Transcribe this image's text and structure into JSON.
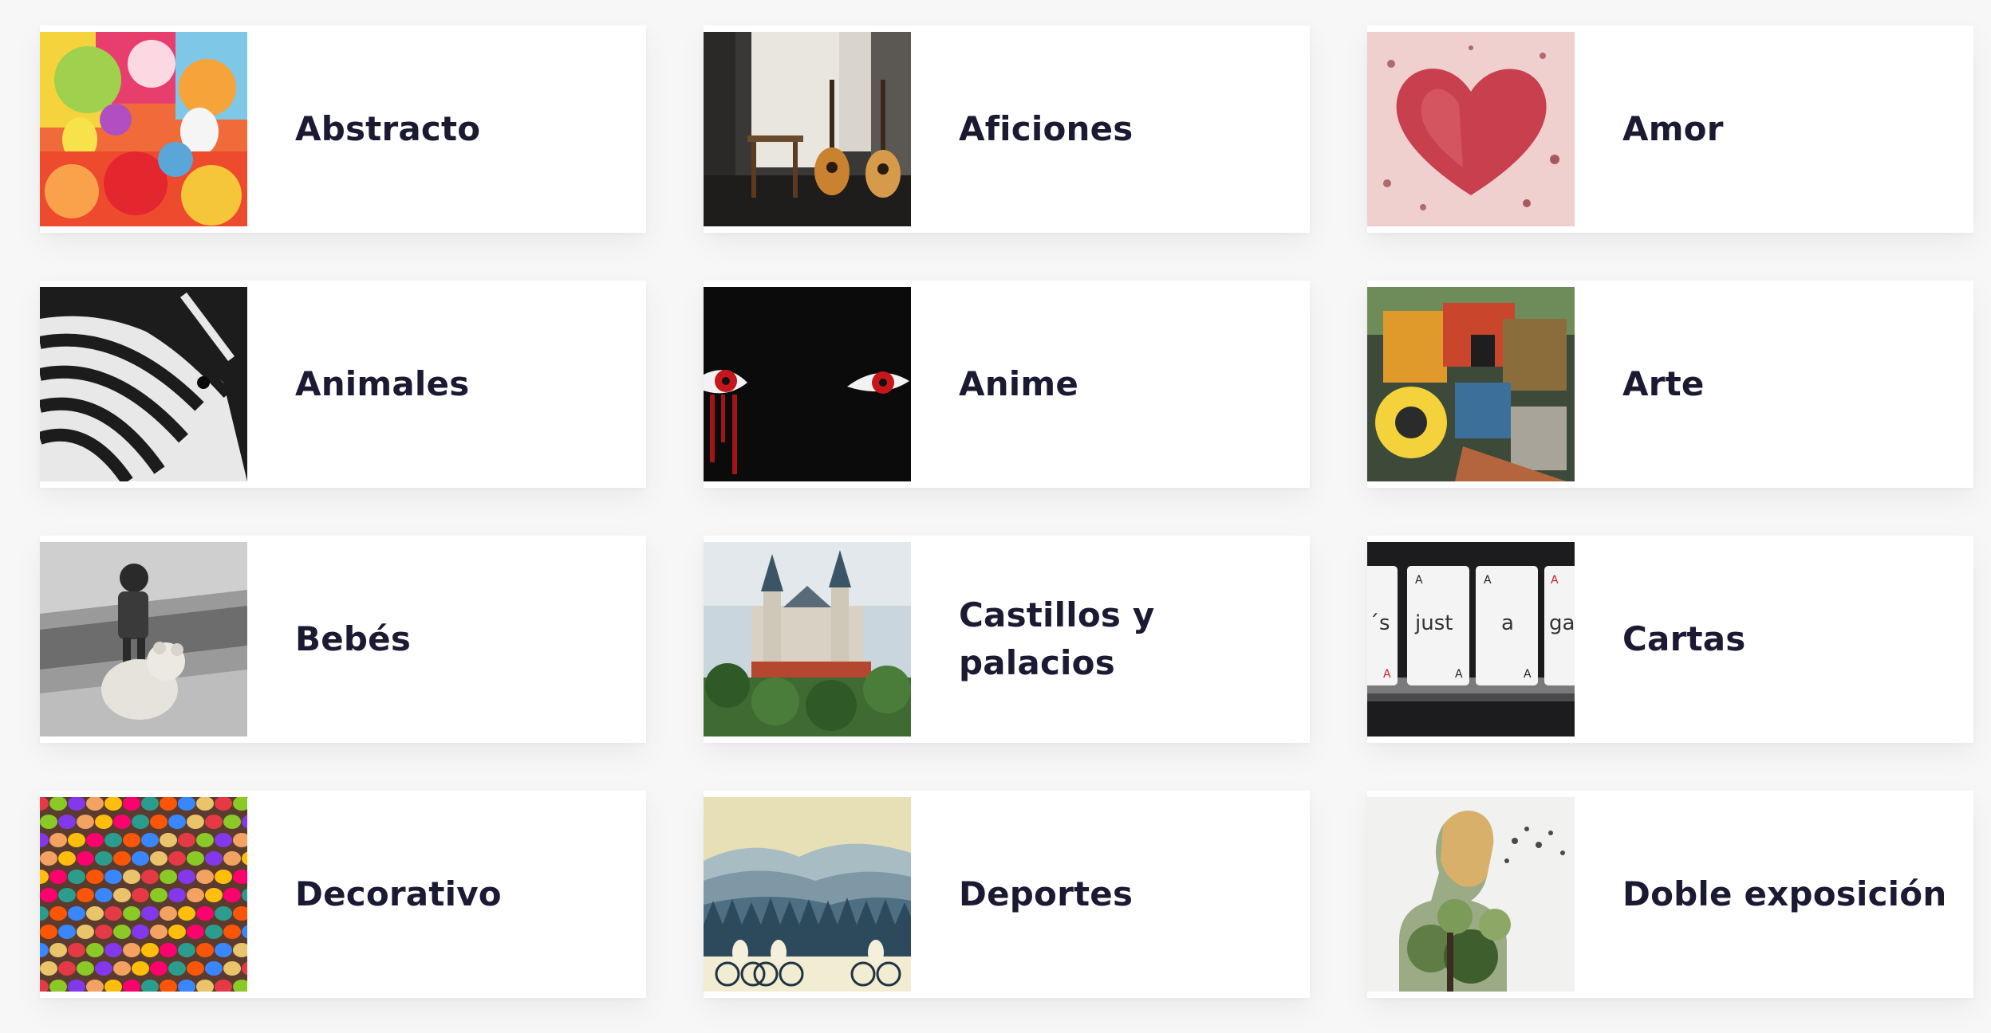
{
  "categories": [
    {
      "label": "Abstracto",
      "icon": "abstract-paint-splash-thumbnail"
    },
    {
      "label": "Aficiones",
      "icon": "guitars-room-thumbnail"
    },
    {
      "label": "Amor",
      "icon": "red-heart-thumbnail"
    },
    {
      "label": "Animales",
      "icon": "zebra-thumbnail"
    },
    {
      "label": "Anime",
      "icon": "anime-eyes-thumbnail"
    },
    {
      "label": "Arte",
      "icon": "graffiti-art-thumbnail"
    },
    {
      "label": "Bebés",
      "icon": "child-with-teddy-bear-thumbnail"
    },
    {
      "label": "Castillos y palacios",
      "icon": "castle-thumbnail"
    },
    {
      "label": "Cartas",
      "icon": "playing-cards-thumbnail"
    },
    {
      "label": "Decorativo",
      "icon": "colorful-candies-thumbnail"
    },
    {
      "label": "Deportes",
      "icon": "cyclists-mountains-thumbnail"
    },
    {
      "label": "Doble exposición",
      "icon": "double-exposure-portrait-thumbnail"
    }
  ],
  "thumb_texts": {
    "cards": [
      "´s",
      "just",
      "a",
      "gar"
    ]
  },
  "colors": {
    "page_background": "#f7f7f7",
    "card_background": "#ffffff",
    "label_text": "#1b1a33"
  }
}
